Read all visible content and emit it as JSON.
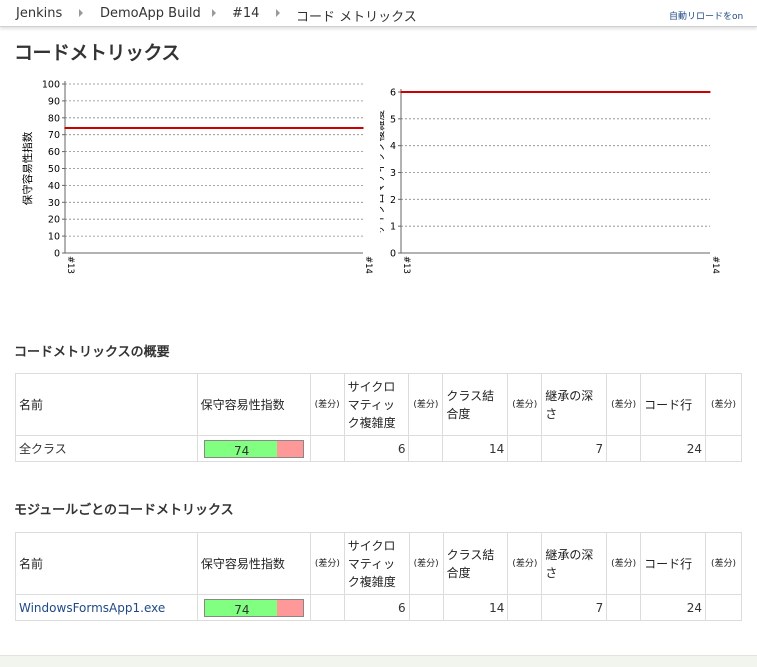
{
  "breadcrumb": {
    "items": [
      "Jenkins",
      "DemoApp Build",
      "#14",
      "コード メトリックス"
    ],
    "auto_refresh": "自動リロードをon"
  },
  "page_title": "コードメトリックス",
  "charts_meta": {
    "line_color": "#cc0000"
  },
  "chart_data": [
    {
      "type": "line",
      "ylabel": "保守容易性指数",
      "xlabel": "",
      "x": [
        "#13",
        "#14"
      ],
      "series": [
        {
          "values": [
            74,
            74
          ]
        }
      ],
      "ylim": [
        0,
        100
      ],
      "yticks": [
        0,
        10,
        20,
        30,
        40,
        50,
        60,
        70,
        80,
        90,
        100
      ],
      "grid": true
    },
    {
      "type": "line",
      "ylabel": "サイクロマティック複雑度",
      "xlabel": "",
      "x": [
        "#13",
        "#14"
      ],
      "series": [
        {
          "values": [
            6,
            6
          ]
        }
      ],
      "ylim": [
        0,
        6
      ],
      "yticks": [
        0,
        1,
        2,
        3,
        4,
        5,
        6
      ],
      "grid": true
    }
  ],
  "summary": {
    "title": "コードメトリックスの概要",
    "headers": [
      "名前",
      "保守容易性指数",
      "(差分)",
      "サイクロマティック複雑度",
      "(差分)",
      "クラス結合度",
      "(差分)",
      "継承の深さ",
      "(差分)",
      "コード行",
      "(差分)"
    ],
    "rows": [
      {
        "name": "全クラス",
        "maintainability": 74,
        "maintainability_fraction": 0.74,
        "cyclomatic": "6",
        "coupling": "14",
        "depth": "7",
        "lines": "24"
      }
    ]
  },
  "modules": {
    "title": "モジュールごとのコードメトリックス",
    "headers": [
      "名前",
      "保守容易性指数",
      "(差分)",
      "サイクロマティック複雑度",
      "(差分)",
      "クラス結合度",
      "(差分)",
      "継承の深さ",
      "(差分)",
      "コード行",
      "(差分)"
    ],
    "rows": [
      {
        "name": "WindowsFormsApp1.exe",
        "maintainability": 74,
        "maintainability_fraction": 0.74,
        "cyclomatic": "6",
        "coupling": "14",
        "depth": "7",
        "lines": "24"
      }
    ]
  }
}
